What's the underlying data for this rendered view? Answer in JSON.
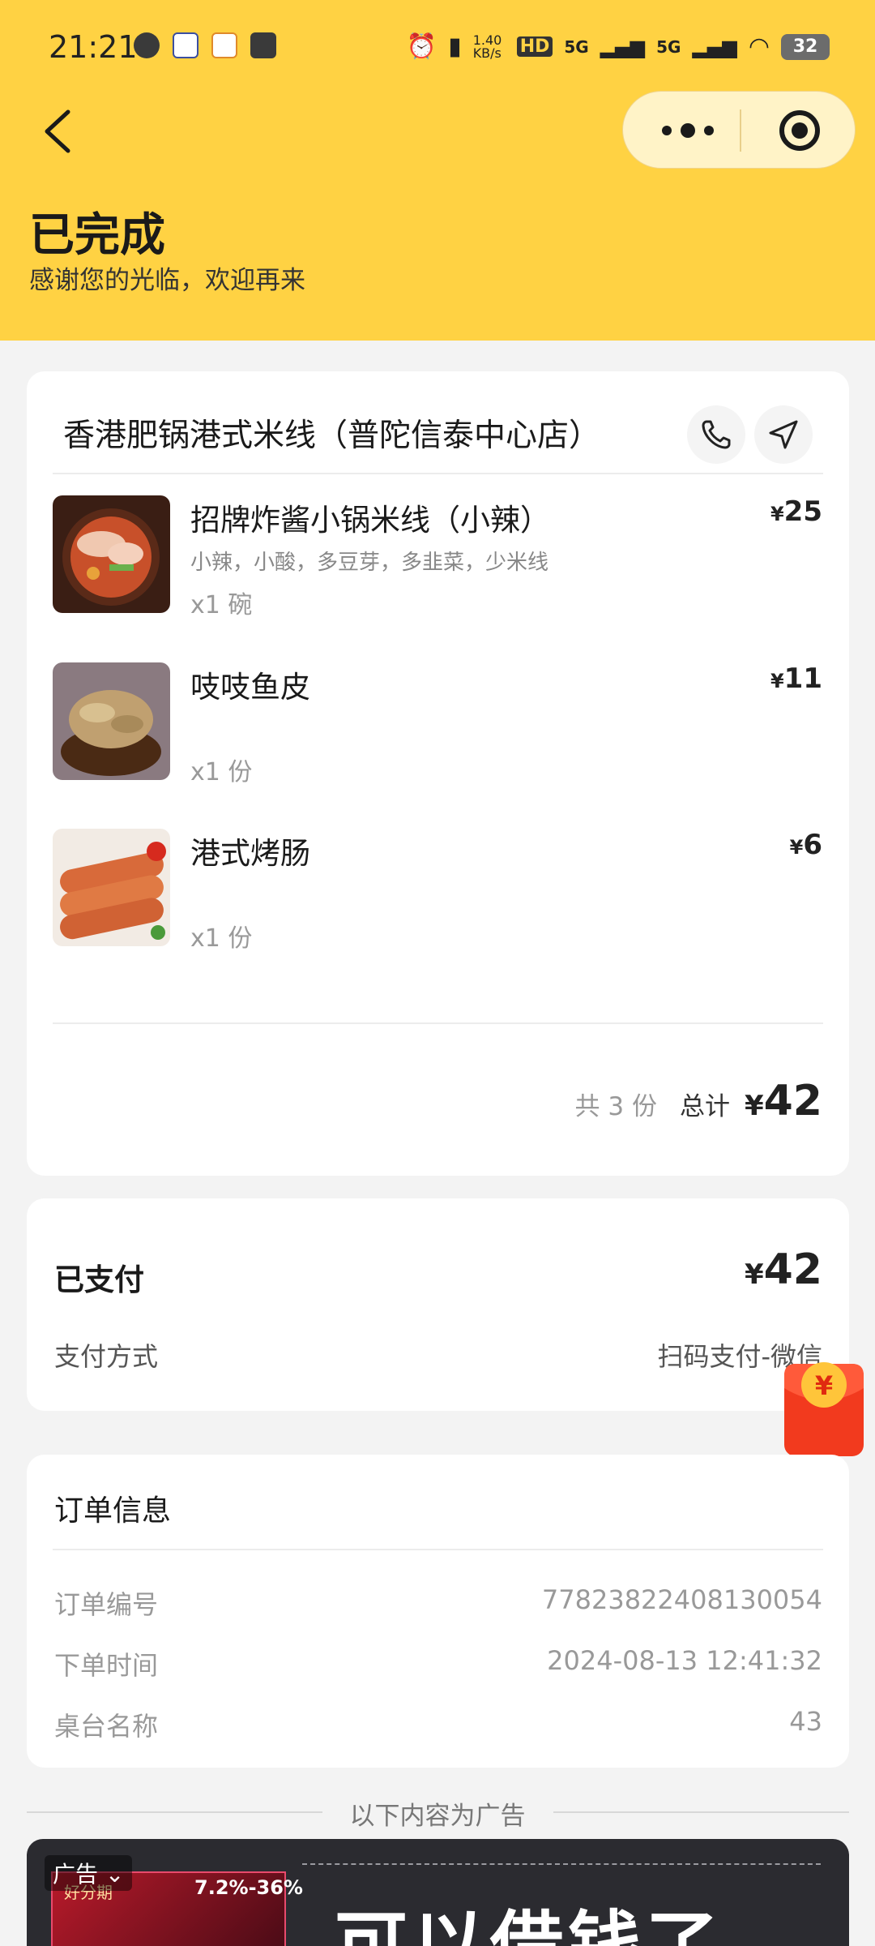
{
  "status_bar": {
    "time": "21:21",
    "network_speed": "1.40 KB/s",
    "signal_1": "5G",
    "signal_2": "5G",
    "battery": "32"
  },
  "header": {
    "title": "已完成",
    "subtitle": "感谢您的光临，欢迎再来"
  },
  "shop": {
    "name": "香港肥锅港式米线（普陀信泰中心店）"
  },
  "items": [
    {
      "name": "招牌炸酱小锅米线（小辣）",
      "spec": "小辣，小酸，多豆芽，多韭菜，少米线",
      "qty": "x1 碗",
      "currency": "¥",
      "price": "25"
    },
    {
      "name": "吱吱鱼皮",
      "spec": "",
      "qty": "x1 份",
      "currency": "¥",
      "price": "11"
    },
    {
      "name": "港式烤肠",
      "spec": "",
      "qty": "x1 份",
      "currency": "¥",
      "price": "6"
    }
  ],
  "summary": {
    "count": "共 3 份",
    "total_label": "总计",
    "currency": "¥",
    "total": "42"
  },
  "payment": {
    "label": "已支付",
    "currency": "¥",
    "amount": "42",
    "method_label": "支付方式",
    "method_value": "扫码支付-微信"
  },
  "order_info": {
    "title": "订单信息",
    "rows": [
      {
        "label": "订单编号",
        "value": "77823822408130054"
      },
      {
        "label": "下单时间",
        "value": "2024-08-13 12:41:32"
      },
      {
        "label": "桌台名称",
        "value": "43"
      }
    ]
  },
  "ad": {
    "divider_text": "以下内容为广告",
    "tag": "广告",
    "thumb_text": "好分期",
    "thumb_rate": "7.2%-36%",
    "headline": "可以借钱了"
  },
  "colors": {
    "header_bg": "#ffd243",
    "capsule_bg": "#fff3c7",
    "page_bg": "#f3f3f3"
  }
}
